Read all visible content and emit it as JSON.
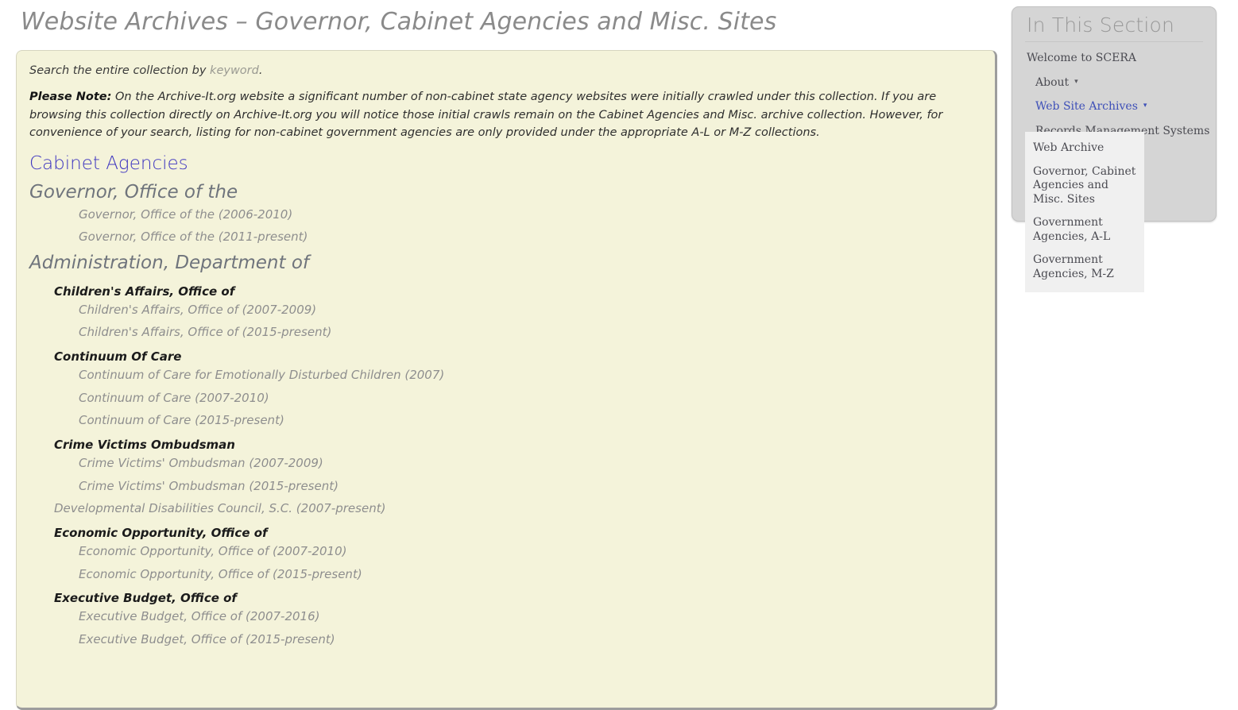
{
  "page": {
    "title": "Website Archives – Governor, Cabinet Agencies and Misc. Sites"
  },
  "content": {
    "search_line_prefix": "Search the entire collection by ",
    "search_keyword_link": "keyword",
    "search_line_suffix": ".",
    "note_label": "Please Note:",
    "note_text": " On the Archive-It.org website a significant number of non-cabinet state agency websites were initially crawled under this collection. If you are browsing this collection directly on Archive-It.org you will notice those initial crawls remain on the Cabinet Agencies and Misc. archive collection. However, for convenience of your search, listing for non-cabinet government agencies are only provided under the appropriate A-L or M-Z collections.",
    "collection_link": "Cabinet Agencies",
    "sections": [
      {
        "heading": "Governor, Office of the",
        "entries": [
          {
            "type": "leaf",
            "label": "Governor, Office of the (2006-2010)"
          },
          {
            "type": "leaf",
            "label": "Governor, Office of the (2011-present)"
          }
        ]
      },
      {
        "heading": "Administration, Department of",
        "entries": [
          {
            "type": "sub",
            "label": "Children's Affairs, Office of"
          },
          {
            "type": "leaf",
            "label": "Children's Affairs, Office of (2007-2009)"
          },
          {
            "type": "leaf",
            "label": "Children's Affairs, Office of (2015-present)"
          },
          {
            "type": "sub",
            "label": "Continuum Of Care"
          },
          {
            "type": "leaf",
            "label": "Continuum of Care for Emotionally Disturbed Children (2007)"
          },
          {
            "type": "leaf",
            "label": "Continuum of Care (2007-2010)"
          },
          {
            "type": "leaf",
            "label": "Continuum of Care (2015-present)"
          },
          {
            "type": "sub",
            "label": "Crime Victims Ombudsman"
          },
          {
            "type": "leaf",
            "label": "Crime Victims' Ombudsman (2007-2009)"
          },
          {
            "type": "leaf",
            "label": "Crime Victims' Ombudsman (2015-present)"
          },
          {
            "type": "leaf2",
            "label": "Developmental Disabilities Council, S.C. (2007-present)"
          },
          {
            "type": "sub",
            "label": "Economic Opportunity, Office of"
          },
          {
            "type": "leaf",
            "label": "Economic Opportunity, Office of (2007-2010)"
          },
          {
            "type": "leaf",
            "label": "Economic Opportunity, Office of (2015-present)"
          },
          {
            "type": "sub",
            "label": "Executive Budget, Office of"
          },
          {
            "type": "leaf",
            "label": "Executive Budget, Office of (2007-2016)"
          },
          {
            "type": "leaf",
            "label": "Executive Budget, Office of (2015-present)"
          }
        ]
      }
    ]
  },
  "sidebar": {
    "title": "In This Section",
    "items": [
      {
        "label": "Welcome to SCERA",
        "indent": false,
        "caret": false,
        "active": false
      },
      {
        "label": "About",
        "indent": true,
        "caret": true,
        "active": false
      },
      {
        "label": "Web Site Archives",
        "indent": true,
        "caret": true,
        "active": true
      },
      {
        "label": "Records Management Systems",
        "indent": true,
        "caret": false,
        "active": false
      }
    ]
  },
  "dropdown": {
    "items": [
      "Web Archive",
      "Governor, Cabinet Agencies and Misc. Sites",
      "Government Agencies, A-L",
      "Government Agencies, M-Z"
    ]
  },
  "icons": {
    "caret_glyph": "▾"
  },
  "colors": {
    "panel_background": "#f4f3da",
    "link_blue": "#3d35c0",
    "nav_active_blue": "#3d4fb8",
    "sidebar_background": "#d5d5d5",
    "dropdown_background": "#f0f0f0",
    "title_gray": "#8a8a8a"
  }
}
